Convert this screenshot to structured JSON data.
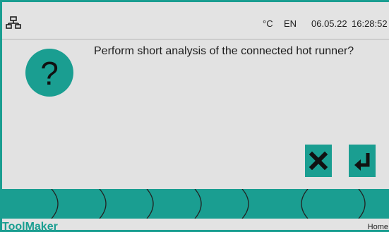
{
  "status_bar": {
    "network_icon": "network-icon",
    "unit": "°C",
    "language": "EN",
    "date": "06.05.22",
    "time": "16:28:52"
  },
  "dialog": {
    "icon": "question-icon",
    "message": "Perform short analysis of the connected hot runner?",
    "cancel_icon": "x-icon",
    "confirm_icon": "enter-icon"
  },
  "tabs": [
    "",
    "",
    "",
    "",
    "",
    "",
    ""
  ],
  "footer": {
    "brand": "ToolMaker",
    "location": "Home"
  },
  "colors": {
    "accent": "#1a9e91",
    "background": "#e2e2e2",
    "text": "#1e1e1e"
  }
}
